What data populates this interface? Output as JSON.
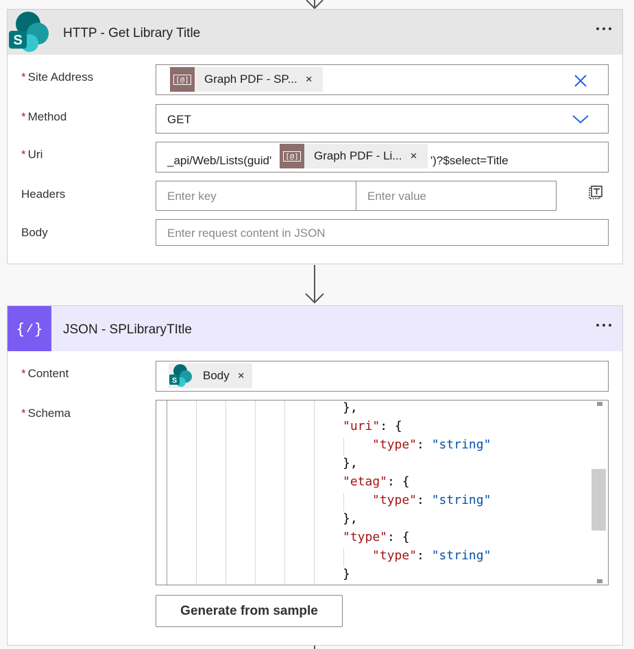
{
  "http_card": {
    "title": "HTTP - Get Library Title",
    "fields": {
      "site_address": {
        "label": "Site Address",
        "required": "*",
        "token": {
          "icon": "[@]",
          "text": "Graph PDF - SP...",
          "remove": "×"
        }
      },
      "method": {
        "label": "Method",
        "required": "*",
        "value": "GET"
      },
      "uri": {
        "label": "Uri",
        "required": "*",
        "prefix": "_api/Web/Lists(guid'",
        "token": {
          "icon": "[@]",
          "text": "Graph PDF - Li...",
          "remove": "×"
        },
        "suffix": "')?$select=Title"
      },
      "headers": {
        "label": "Headers",
        "key_placeholder": "Enter key",
        "value_placeholder": "Enter value"
      },
      "body": {
        "label": "Body",
        "placeholder": "Enter request content in JSON"
      }
    }
  },
  "json_card": {
    "title": "JSON - SPLibraryTItle",
    "fields": {
      "content": {
        "label": "Content",
        "required": "*",
        "token": {
          "text": "Body",
          "remove": "×"
        }
      },
      "schema": {
        "label": "Schema",
        "required": "*",
        "lines": [
          {
            "k": "",
            "t": "},"
          },
          {
            "k": "\"uri\"",
            "t": ": {"
          },
          {
            "k": "\"type\"",
            "t": ": ",
            "v": "\"string\""
          },
          {
            "k": "",
            "t": "},"
          },
          {
            "k": "\"etag\"",
            "t": ": {"
          },
          {
            "k": "\"type\"",
            "t": ": ",
            "v": "\"string\""
          },
          {
            "k": "",
            "t": "},"
          },
          {
            "k": "\"type\"",
            "t": ": {"
          },
          {
            "k": "\"type\"",
            "t": ": ",
            "v": "\"string\""
          },
          {
            "k": "",
            "t": "}"
          }
        ]
      }
    },
    "generate_button": "Generate from sample"
  },
  "colors": {
    "http_header_bg": "#e6e6e6",
    "json_header_bg": "#ede9fd",
    "json_icon_bg": "#7b5cf2",
    "token_icon_bg": "#8c6e6c",
    "required": "#a4262c",
    "accent_blue": "#2266e3"
  }
}
